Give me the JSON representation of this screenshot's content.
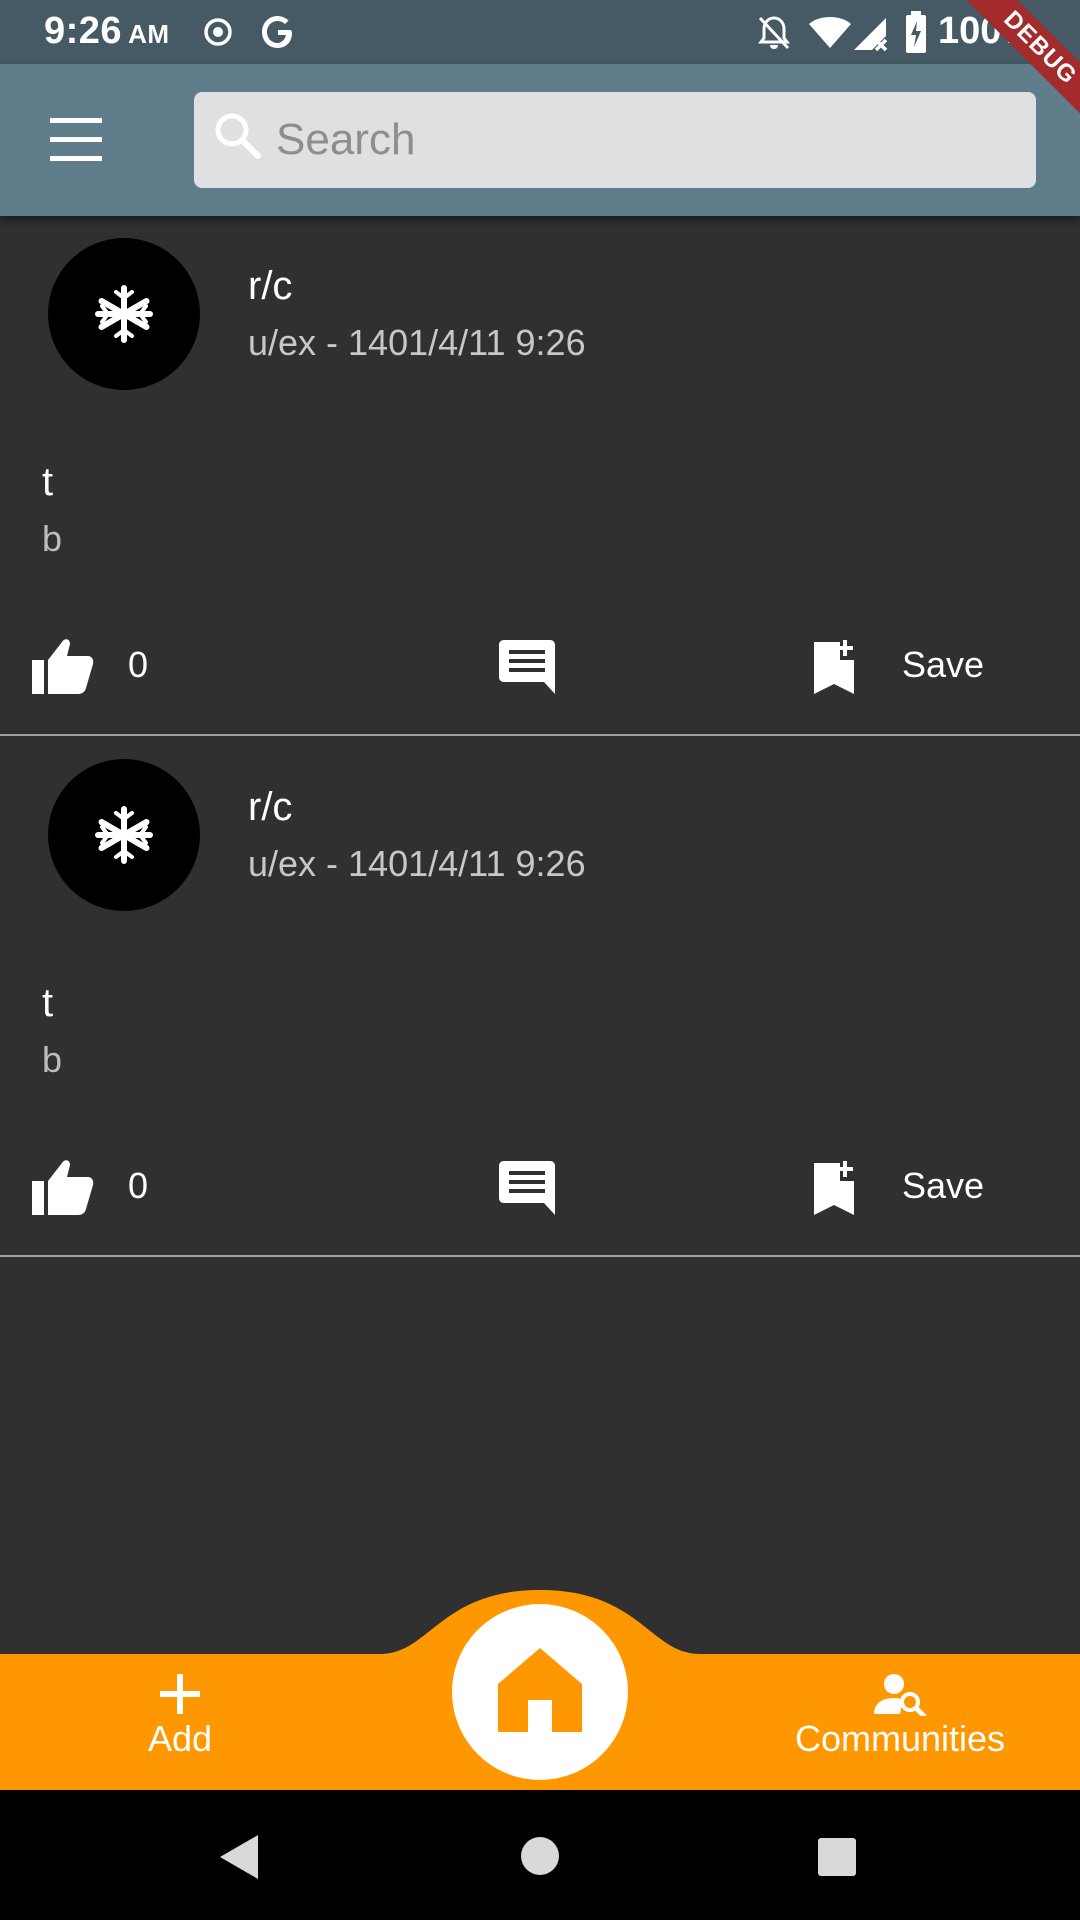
{
  "status_bar": {
    "time": "9:26",
    "ampm": "AM",
    "battery": "100%",
    "icons": [
      "location-icon",
      "google-icon",
      "notifications-off-icon",
      "wifi-icon",
      "signal-icon",
      "battery-charging-icon"
    ]
  },
  "debug_banner": "DEBUG",
  "app_bar": {
    "search": {
      "placeholder": "Search",
      "value": ""
    }
  },
  "posts": [
    {
      "community": "r/c",
      "meta": "u/ex - 1401/4/11 9:26",
      "title": "t",
      "body": "b",
      "likes": "0",
      "save_label": "Save"
    },
    {
      "community": "r/c",
      "meta": "u/ex - 1401/4/11 9:26",
      "title": "t",
      "body": "b",
      "likes": "0",
      "save_label": "Save"
    }
  ],
  "bottom_nav": {
    "add_label": "Add",
    "communities_label": "Communities"
  },
  "colors": {
    "background": "#303030",
    "app_bar": "#607d8b",
    "status_bar": "#455a64",
    "accent": "#ff9800",
    "debug": "#a32b2b"
  }
}
